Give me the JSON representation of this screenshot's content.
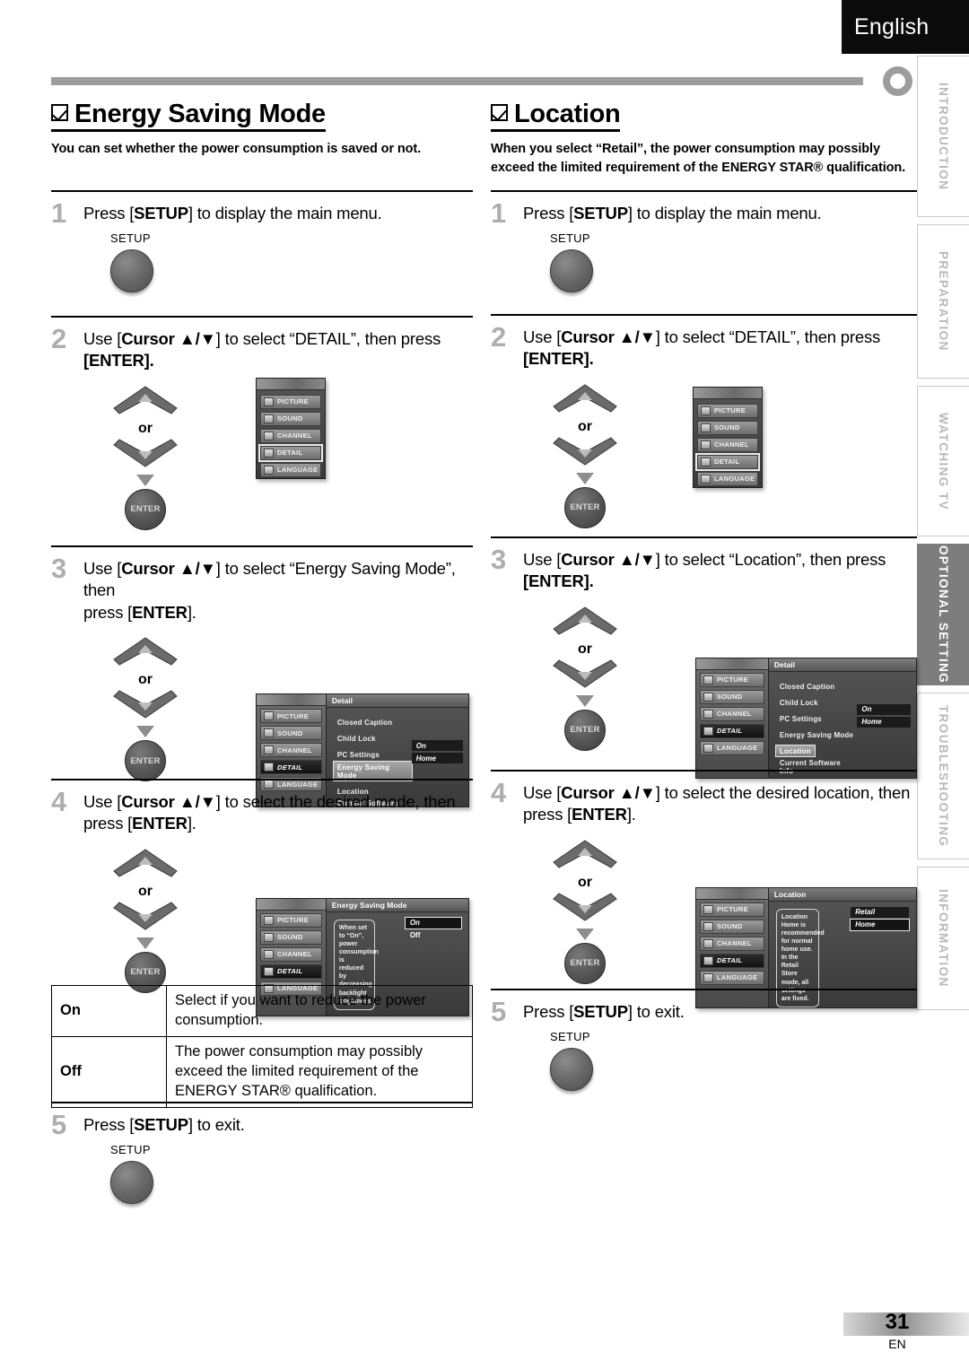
{
  "header": {
    "language": "English"
  },
  "sidebar": {
    "tabs": [
      {
        "label": "INTRODUCTION",
        "active": false
      },
      {
        "label": "PREPARATION",
        "active": false
      },
      {
        "label": "WATCHING TV",
        "active": false
      },
      {
        "label": "OPTIONAL SETTING",
        "active": true
      },
      {
        "label": "TROUBLESHOOTING",
        "active": false
      },
      {
        "label": "INFORMATION",
        "active": false
      }
    ]
  },
  "left": {
    "title": "Energy Saving Mode",
    "description": "You can set whether the power consumption is saved or not.",
    "steps": {
      "s1": {
        "num": "1",
        "text_a": "Press [",
        "bold": "SETUP",
        "text_b": "] to display the main menu.",
        "button_label": "SETUP"
      },
      "s2": {
        "num": "2",
        "line1_a": "Use [",
        "line1_b": "Cursor ▲/▼",
        "line1_c": "] to select “DETAIL”, then press",
        "line2": "[ENTER]."
      },
      "s3": {
        "num": "3",
        "line1_a": "Use [",
        "line1_b": "Cursor ▲/▼",
        "line1_c": "] to select “Energy Saving Mode”, then",
        "line2_a": "press [",
        "line2_b": "ENTER",
        "line2_c": "]."
      },
      "s4": {
        "num": "4",
        "line1_a": "Use [",
        "line1_b": "Cursor ▲/▼",
        "line1_c": "] to select the desired mode, then",
        "line2_a": "press [",
        "line2_b": "ENTER",
        "line2_c": "]."
      },
      "s5": {
        "num": "5",
        "text_a": "Press [",
        "bold": "SETUP",
        "text_b": "] to exit.",
        "button_label": "SETUP"
      }
    },
    "or_label": "or",
    "enter_label": "ENTER",
    "menu_step2": {
      "items": [
        "PICTURE",
        "SOUND",
        "CHANNEL",
        "DETAIL",
        "LANGUAGE"
      ],
      "highlighted": "DETAIL"
    },
    "menu_step3": {
      "title": "Detail",
      "side_items": [
        "PICTURE",
        "SOUND",
        "CHANNEL",
        "DETAIL",
        "LANGUAGE"
      ],
      "side_selected": "DETAIL",
      "rows": [
        "Closed Caption",
        "Child Lock",
        "PC Settings",
        "Energy Saving Mode",
        "Location",
        "Current Software Info"
      ],
      "highlighted_row": "Energy Saving Mode",
      "values": [
        {
          "label": "On",
          "boxed": false
        },
        {
          "label": "Home",
          "boxed": false
        }
      ]
    },
    "menu_step4": {
      "title": "Energy Saving Mode",
      "side_items": [
        "PICTURE",
        "SOUND",
        "CHANNEL",
        "DETAIL",
        "LANGUAGE"
      ],
      "side_selected": "DETAIL",
      "help_text": "When set to “On”, power consumption is reduced by decreasing backlight brightness.",
      "options": [
        {
          "label": "On",
          "selected": true
        },
        {
          "label": "Off",
          "selected": false
        }
      ]
    },
    "table": {
      "rows": [
        {
          "key": "On",
          "value": "Select if you want to reduce the power consumption."
        },
        {
          "key": "Off",
          "value": "The power consumption may possibly exceed the limited requirement of the ENERGY STAR® qualification."
        }
      ]
    }
  },
  "right": {
    "title": "Location",
    "description": "When you select “Retail”, the power consumption may possibly exceed the limited requirement of the ENERGY STAR® qualification.",
    "steps": {
      "s1": {
        "num": "1",
        "text_a": "Press [",
        "bold": "SETUP",
        "text_b": "] to display the main menu.",
        "button_label": "SETUP"
      },
      "s2": {
        "num": "2",
        "line1_a": "Use [",
        "line1_b": "Cursor ▲/▼",
        "line1_c": "] to select “DETAIL”, then press",
        "line2": "[ENTER]."
      },
      "s3": {
        "num": "3",
        "line1_a": "Use [",
        "line1_b": "Cursor ▲/▼",
        "line1_c": "] to select “Location”, then press",
        "line2": "[ENTER]."
      },
      "s4": {
        "num": "4",
        "line1_a": "Use [",
        "line1_b": "Cursor ▲/▼",
        "line1_c": "] to select the desired location, then",
        "line2_a": "press [",
        "line2_b": "ENTER",
        "line2_c": "]."
      },
      "s5": {
        "num": "5",
        "text_a": "Press [",
        "bold": "SETUP",
        "text_b": "] to exit.",
        "button_label": "SETUP"
      }
    },
    "or_label": "or",
    "enter_label": "ENTER",
    "menu_step2": {
      "items": [
        "PICTURE",
        "SOUND",
        "CHANNEL",
        "DETAIL",
        "LANGUAGE"
      ],
      "highlighted": "DETAIL"
    },
    "menu_step3": {
      "title": "Detail",
      "side_items": [
        "PICTURE",
        "SOUND",
        "CHANNEL",
        "DETAIL",
        "LANGUAGE"
      ],
      "side_selected": "DETAIL",
      "rows": [
        "Closed Caption",
        "Child Lock",
        "PC Settings",
        "Energy Saving Mode",
        "Location",
        "Current Software Info"
      ],
      "highlighted_row": "Location",
      "values": [
        {
          "label": "On",
          "boxed": false
        },
        {
          "label": "Home",
          "boxed": false
        }
      ]
    },
    "menu_step4": {
      "title": "Location",
      "side_items": [
        "PICTURE",
        "SOUND",
        "CHANNEL",
        "DETAIL",
        "LANGUAGE"
      ],
      "side_selected": "DETAIL",
      "help_text": "Location Home is recommended for normal home use. In the Retail Store mode, all settings are fixed.",
      "options": [
        {
          "label": "Retail",
          "selected": false
        },
        {
          "label": "Home",
          "selected": true
        }
      ]
    }
  },
  "footer": {
    "page": "31",
    "lang_code": "EN"
  }
}
